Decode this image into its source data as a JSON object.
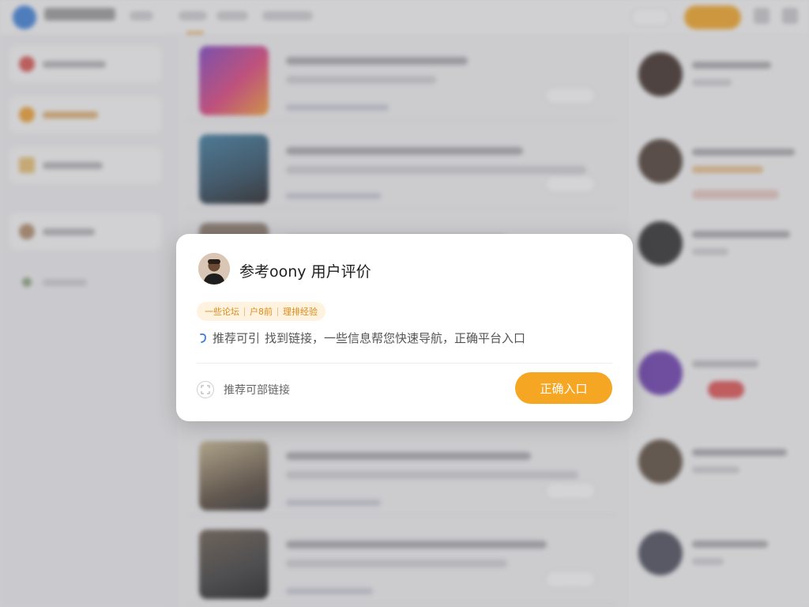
{
  "colors": {
    "accent": "#f5a623",
    "tag_background": "#fff3e0",
    "tag_text": "#d98b1a",
    "link_blue": "#3b7fd9",
    "overlay": "rgba(120,120,128,0.32)",
    "modal_background": "#ffffff"
  },
  "background": {
    "header": {
      "app_name": "",
      "tabs": [
        "",
        ""
      ],
      "login_label": "",
      "register_label": ""
    },
    "sidebar": {
      "items": [
        {
          "label": "",
          "icon": "avatar-icon"
        },
        {
          "label": "",
          "icon": "orange-circle-icon"
        },
        {
          "label": "",
          "icon": "document-icon"
        },
        {
          "label": "",
          "icon": "avatar-icon"
        },
        {
          "label": "",
          "icon": "leaf-icon"
        }
      ]
    },
    "feed": {
      "cards": [
        {
          "title": "",
          "summary": ""
        },
        {
          "title": "",
          "summary": ""
        },
        {
          "title": "",
          "summary": ""
        },
        {
          "title": "",
          "summary": ""
        },
        {
          "title": "",
          "summary": ""
        }
      ]
    },
    "users": {
      "rows": [
        {
          "name": "",
          "subtitle": ""
        },
        {
          "name": "",
          "subtitle": ""
        },
        {
          "name": "",
          "subtitle": ""
        },
        {
          "name": "",
          "subtitle": ""
        },
        {
          "name": "",
          "subtitle": ""
        },
        {
          "name": "",
          "subtitle": ""
        }
      ]
    }
  },
  "modal": {
    "title": "参考oony 用户评价",
    "corner_text": "",
    "tags": [
      "一些论坛",
      "户8前",
      "理排经验"
    ],
    "info_text": "推荐可引",
    "info_text_2": "找到链接，一些信息帮您快速导航，正确平台入口",
    "footer_link_label": "推荐可部链接",
    "primary_button_label": "正确入口",
    "icons": {
      "avatar": "user-avatar-icon",
      "info": "info-icon",
      "link": "expand-icon",
      "close": "close-icon"
    }
  }
}
